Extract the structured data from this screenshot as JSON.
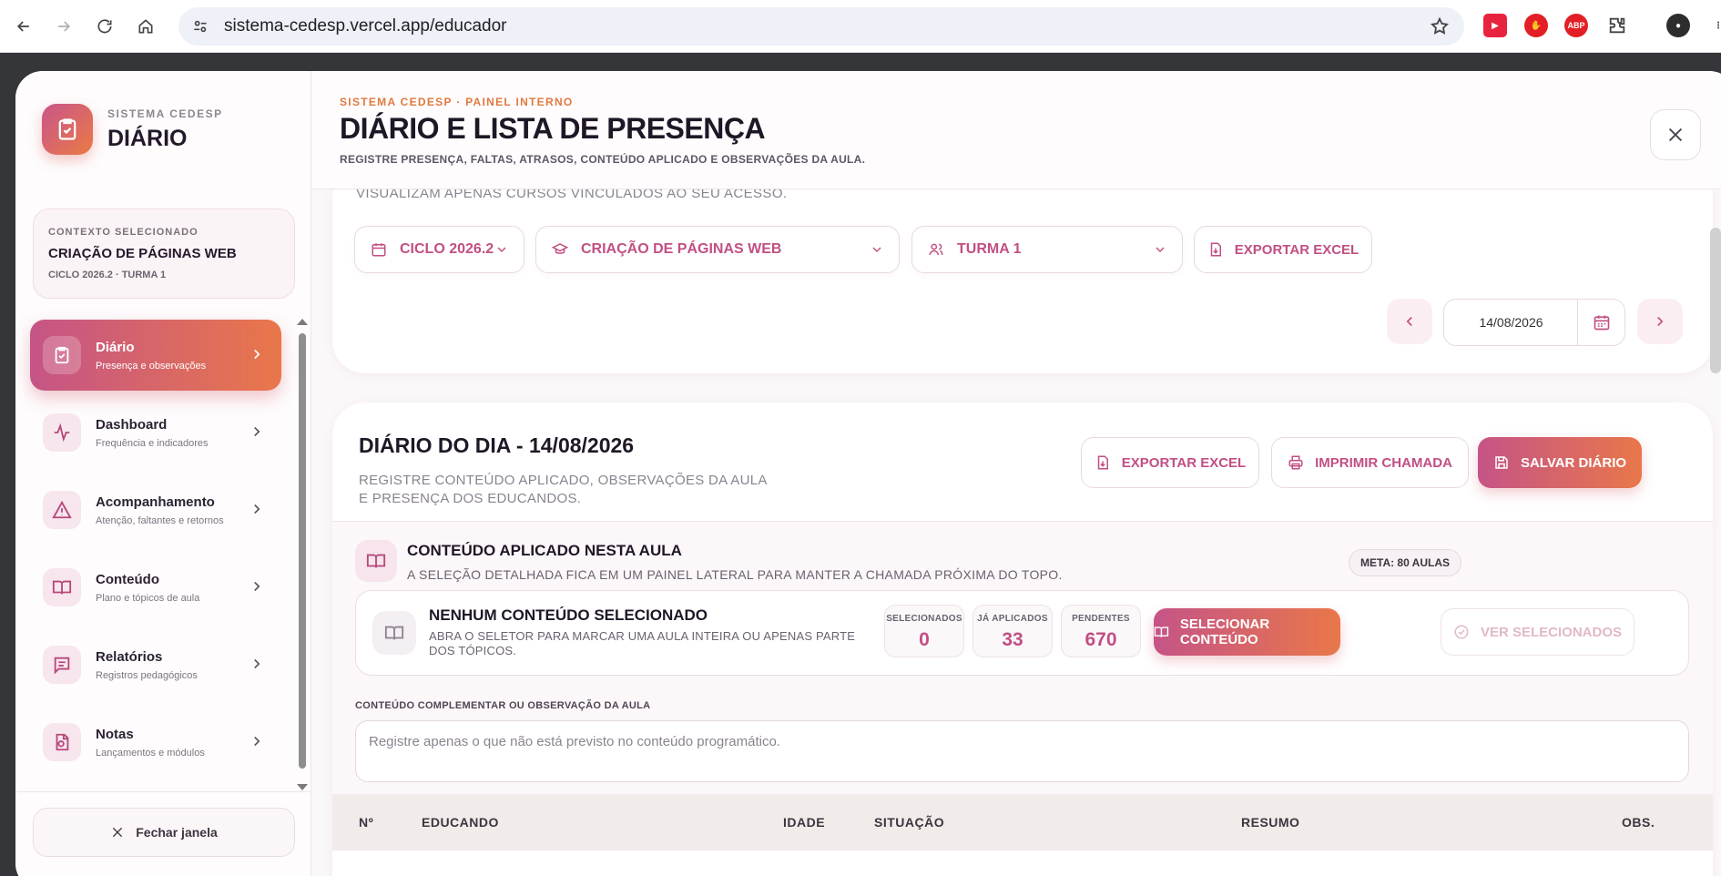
{
  "browser": {
    "url": "sistema-cedesp.vercel.app/educador"
  },
  "sidebar": {
    "brand_small": "SISTEMA CEDESP",
    "brand_big": "DIÁRIO",
    "context": {
      "label": "CONTEXTO SELECIONADO",
      "title": "CRIAÇÃO DE PÁGINAS WEB",
      "sub": "CICLO 2026.2 · TURMA 1"
    },
    "items": [
      {
        "title": "Diário",
        "sub": "Presença e observações",
        "icon": "clipboard-check-icon"
      },
      {
        "title": "Dashboard",
        "sub": "Frequência e indicadores",
        "icon": "activity-icon"
      },
      {
        "title": "Acompanhamento",
        "sub": "Atenção, faltantes e retornos",
        "icon": "alert-triangle-icon"
      },
      {
        "title": "Conteúdo",
        "sub": "Plano e tópicos de aula",
        "icon": "book-open-icon"
      },
      {
        "title": "Relatórios",
        "sub": "Registros pedagógicos",
        "icon": "message-lines-icon"
      },
      {
        "title": "Notas",
        "sub": "Lançamentos e módulos",
        "icon": "file-badge-icon"
      }
    ],
    "close_label": "Fechar janela"
  },
  "header": {
    "kicker": "SISTEMA CEDESP · PAINEL INTERNO",
    "title": "DIÁRIO E LISTA DE PRESENÇA",
    "subtitle": "REGISTRE PRESENÇA, FALTAS, ATRASOS, CONTEÚDO APLICADO E OBSERVAÇÕES DA AULA."
  },
  "filters": {
    "clipped_text": "VISUALIZAM APENAS CURSOS VINCULADOS AO SEU ACESSO.",
    "cycle": "CICLO 2026.2",
    "course": "CRIAÇÃO DE PÁGINAS WEB",
    "class": "TURMA 1",
    "export_label": "EXPORTAR EXCEL",
    "date": "14/08/2026"
  },
  "diary": {
    "title": "DIÁRIO DO DIA - 14/08/2026",
    "subtitle": "REGISTRE CONTEÚDO APLICADO, OBSERVAÇÕES DA AULA E PRESENÇA DOS EDUCANDOS.",
    "export_label": "EXPORTAR EXCEL",
    "print_label": "IMPRIMIR CHAMADA",
    "save_label": "SALVAR DIÁRIO",
    "content": {
      "title": "CONTEÚDO APLICADO NESTA AULA",
      "subtitle": "A SELEÇÃO DETALHADA FICA EM UM PAINEL LATERAL PARA MANTER A CHAMADA PRÓXIMA DO TOPO.",
      "meta": "META: 80 AULAS",
      "none_title": "NENHUM CONTEÚDO SELECIONADO",
      "none_sub": "ABRA O SELETOR PARA MARCAR UMA AULA INTEIRA OU APENAS PARTE DOS TÓPICOS.",
      "stats": [
        {
          "label": "SELECIONADOS",
          "value": "0"
        },
        {
          "label": "JÁ APLICADOS",
          "value": "33"
        },
        {
          "label": "PENDENTES",
          "value": "670"
        }
      ],
      "select_label": "SELECIONAR CONTEÚDO",
      "view_label": "VER SELECIONADOS"
    },
    "obs_label": "CONTEÚDO COMPLEMENTAR OU OBSERVAÇÃO DA AULA",
    "obs_placeholder": "Registre apenas o que não está previsto no conteúdo programático.",
    "table_headers": [
      "Nº",
      "EDUCANDO",
      "IDADE",
      "SITUAÇÃO",
      "RESUMO",
      "OBS."
    ]
  },
  "colors": {
    "accent_start": "#c55487",
    "accent_end": "#e9774a",
    "accent_text": "#c24f83"
  }
}
